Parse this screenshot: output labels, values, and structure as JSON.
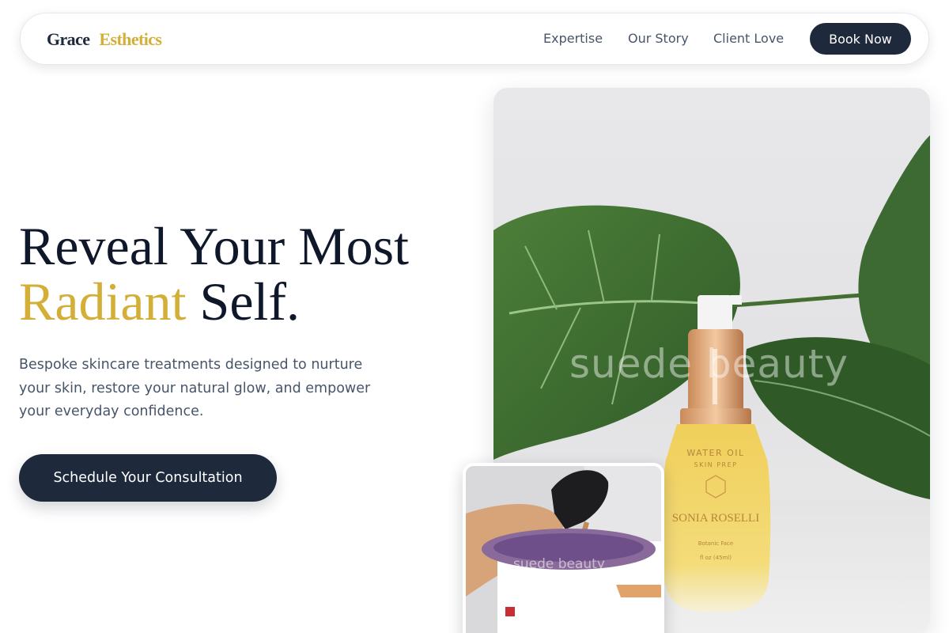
{
  "brand": {
    "name_first": "Grace",
    "name_second": "Esthetics",
    "accent_color": "#d4af37",
    "primary_color": "#1e293b"
  },
  "nav": {
    "links": [
      "Expertise",
      "Our Story",
      "Client Love"
    ],
    "cta_label": "Book Now"
  },
  "hero": {
    "title_line1": "Reveal Your Most",
    "title_accent": "Radiant",
    "title_end": " Self.",
    "subtitle": "Bespoke skincare treatments designed to nurture your skin, restore your natural glow, and empower your everyday confidence.",
    "cta_label": "Schedule Your Consultation"
  },
  "images": {
    "main": {
      "watermark": "suede beauty",
      "bottle_label_line1": "WATER OIL",
      "bottle_label_line2": "SKIN PREP",
      "bottle_brand": "SONIA ROSELLI",
      "bottle_small1": "Botanic Face",
      "bottle_small2": "fl oz (45ml)"
    },
    "secondary": {
      "watermark": "suede beauty"
    }
  }
}
